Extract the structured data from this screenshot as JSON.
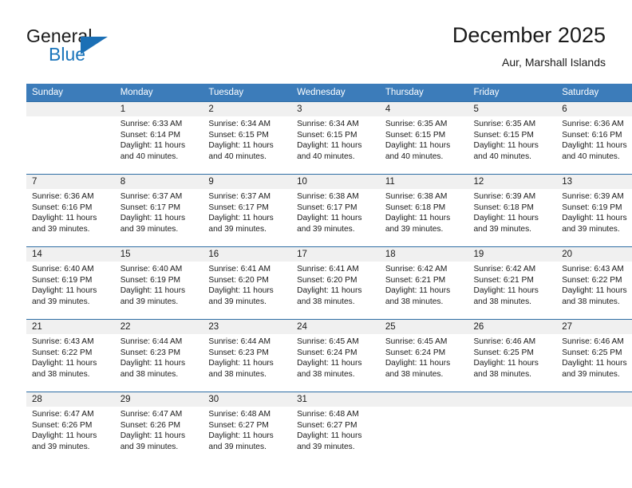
{
  "brand": {
    "name_top": "General",
    "name_bottom": "Blue",
    "accent_color": "#1b75bb",
    "logo_icon": "triangle-flag-icon"
  },
  "header": {
    "month_title": "December 2025",
    "location": "Aur, Marshall Islands"
  },
  "calendar": {
    "header_bg": "#3c7cba",
    "row_divider_color": "#2e6da4",
    "daynum_band_bg": "#f0f0f0",
    "weekday_headers": [
      "Sunday",
      "Monday",
      "Tuesday",
      "Wednesday",
      "Thursday",
      "Friday",
      "Saturday"
    ],
    "weeks": [
      [
        {
          "day": "",
          "sunrise": "",
          "sunset": "",
          "daylight_line1": "",
          "daylight_line2": "",
          "empty": true
        },
        {
          "day": "1",
          "sunrise": "Sunrise: 6:33 AM",
          "sunset": "Sunset: 6:14 PM",
          "daylight_line1": "Daylight: 11 hours",
          "daylight_line2": "and 40 minutes."
        },
        {
          "day": "2",
          "sunrise": "Sunrise: 6:34 AM",
          "sunset": "Sunset: 6:15 PM",
          "daylight_line1": "Daylight: 11 hours",
          "daylight_line2": "and 40 minutes."
        },
        {
          "day": "3",
          "sunrise": "Sunrise: 6:34 AM",
          "sunset": "Sunset: 6:15 PM",
          "daylight_line1": "Daylight: 11 hours",
          "daylight_line2": "and 40 minutes."
        },
        {
          "day": "4",
          "sunrise": "Sunrise: 6:35 AM",
          "sunset": "Sunset: 6:15 PM",
          "daylight_line1": "Daylight: 11 hours",
          "daylight_line2": "and 40 minutes."
        },
        {
          "day": "5",
          "sunrise": "Sunrise: 6:35 AM",
          "sunset": "Sunset: 6:15 PM",
          "daylight_line1": "Daylight: 11 hours",
          "daylight_line2": "and 40 minutes."
        },
        {
          "day": "6",
          "sunrise": "Sunrise: 6:36 AM",
          "sunset": "Sunset: 6:16 PM",
          "daylight_line1": "Daylight: 11 hours",
          "daylight_line2": "and 40 minutes."
        }
      ],
      [
        {
          "day": "7",
          "sunrise": "Sunrise: 6:36 AM",
          "sunset": "Sunset: 6:16 PM",
          "daylight_line1": "Daylight: 11 hours",
          "daylight_line2": "and 39 minutes."
        },
        {
          "day": "8",
          "sunrise": "Sunrise: 6:37 AM",
          "sunset": "Sunset: 6:17 PM",
          "daylight_line1": "Daylight: 11 hours",
          "daylight_line2": "and 39 minutes."
        },
        {
          "day": "9",
          "sunrise": "Sunrise: 6:37 AM",
          "sunset": "Sunset: 6:17 PM",
          "daylight_line1": "Daylight: 11 hours",
          "daylight_line2": "and 39 minutes."
        },
        {
          "day": "10",
          "sunrise": "Sunrise: 6:38 AM",
          "sunset": "Sunset: 6:17 PM",
          "daylight_line1": "Daylight: 11 hours",
          "daylight_line2": "and 39 minutes."
        },
        {
          "day": "11",
          "sunrise": "Sunrise: 6:38 AM",
          "sunset": "Sunset: 6:18 PM",
          "daylight_line1": "Daylight: 11 hours",
          "daylight_line2": "and 39 minutes."
        },
        {
          "day": "12",
          "sunrise": "Sunrise: 6:39 AM",
          "sunset": "Sunset: 6:18 PM",
          "daylight_line1": "Daylight: 11 hours",
          "daylight_line2": "and 39 minutes."
        },
        {
          "day": "13",
          "sunrise": "Sunrise: 6:39 AM",
          "sunset": "Sunset: 6:19 PM",
          "daylight_line1": "Daylight: 11 hours",
          "daylight_line2": "and 39 minutes."
        }
      ],
      [
        {
          "day": "14",
          "sunrise": "Sunrise: 6:40 AM",
          "sunset": "Sunset: 6:19 PM",
          "daylight_line1": "Daylight: 11 hours",
          "daylight_line2": "and 39 minutes."
        },
        {
          "day": "15",
          "sunrise": "Sunrise: 6:40 AM",
          "sunset": "Sunset: 6:19 PM",
          "daylight_line1": "Daylight: 11 hours",
          "daylight_line2": "and 39 minutes."
        },
        {
          "day": "16",
          "sunrise": "Sunrise: 6:41 AM",
          "sunset": "Sunset: 6:20 PM",
          "daylight_line1": "Daylight: 11 hours",
          "daylight_line2": "and 39 minutes."
        },
        {
          "day": "17",
          "sunrise": "Sunrise: 6:41 AM",
          "sunset": "Sunset: 6:20 PM",
          "daylight_line1": "Daylight: 11 hours",
          "daylight_line2": "and 38 minutes."
        },
        {
          "day": "18",
          "sunrise": "Sunrise: 6:42 AM",
          "sunset": "Sunset: 6:21 PM",
          "daylight_line1": "Daylight: 11 hours",
          "daylight_line2": "and 38 minutes."
        },
        {
          "day": "19",
          "sunrise": "Sunrise: 6:42 AM",
          "sunset": "Sunset: 6:21 PM",
          "daylight_line1": "Daylight: 11 hours",
          "daylight_line2": "and 38 minutes."
        },
        {
          "day": "20",
          "sunrise": "Sunrise: 6:43 AM",
          "sunset": "Sunset: 6:22 PM",
          "daylight_line1": "Daylight: 11 hours",
          "daylight_line2": "and 38 minutes."
        }
      ],
      [
        {
          "day": "21",
          "sunrise": "Sunrise: 6:43 AM",
          "sunset": "Sunset: 6:22 PM",
          "daylight_line1": "Daylight: 11 hours",
          "daylight_line2": "and 38 minutes."
        },
        {
          "day": "22",
          "sunrise": "Sunrise: 6:44 AM",
          "sunset": "Sunset: 6:23 PM",
          "daylight_line1": "Daylight: 11 hours",
          "daylight_line2": "and 38 minutes."
        },
        {
          "day": "23",
          "sunrise": "Sunrise: 6:44 AM",
          "sunset": "Sunset: 6:23 PM",
          "daylight_line1": "Daylight: 11 hours",
          "daylight_line2": "and 38 minutes."
        },
        {
          "day": "24",
          "sunrise": "Sunrise: 6:45 AM",
          "sunset": "Sunset: 6:24 PM",
          "daylight_line1": "Daylight: 11 hours",
          "daylight_line2": "and 38 minutes."
        },
        {
          "day": "25",
          "sunrise": "Sunrise: 6:45 AM",
          "sunset": "Sunset: 6:24 PM",
          "daylight_line1": "Daylight: 11 hours",
          "daylight_line2": "and 38 minutes."
        },
        {
          "day": "26",
          "sunrise": "Sunrise: 6:46 AM",
          "sunset": "Sunset: 6:25 PM",
          "daylight_line1": "Daylight: 11 hours",
          "daylight_line2": "and 38 minutes."
        },
        {
          "day": "27",
          "sunrise": "Sunrise: 6:46 AM",
          "sunset": "Sunset: 6:25 PM",
          "daylight_line1": "Daylight: 11 hours",
          "daylight_line2": "and 39 minutes."
        }
      ],
      [
        {
          "day": "28",
          "sunrise": "Sunrise: 6:47 AM",
          "sunset": "Sunset: 6:26 PM",
          "daylight_line1": "Daylight: 11 hours",
          "daylight_line2": "and 39 minutes."
        },
        {
          "day": "29",
          "sunrise": "Sunrise: 6:47 AM",
          "sunset": "Sunset: 6:26 PM",
          "daylight_line1": "Daylight: 11 hours",
          "daylight_line2": "and 39 minutes."
        },
        {
          "day": "30",
          "sunrise": "Sunrise: 6:48 AM",
          "sunset": "Sunset: 6:27 PM",
          "daylight_line1": "Daylight: 11 hours",
          "daylight_line2": "and 39 minutes."
        },
        {
          "day": "31",
          "sunrise": "Sunrise: 6:48 AM",
          "sunset": "Sunset: 6:27 PM",
          "daylight_line1": "Daylight: 11 hours",
          "daylight_line2": "and 39 minutes."
        },
        {
          "day": "",
          "sunrise": "",
          "sunset": "",
          "daylight_line1": "",
          "daylight_line2": "",
          "empty": true
        },
        {
          "day": "",
          "sunrise": "",
          "sunset": "",
          "daylight_line1": "",
          "daylight_line2": "",
          "empty": true
        },
        {
          "day": "",
          "sunrise": "",
          "sunset": "",
          "daylight_line1": "",
          "daylight_line2": "",
          "empty": true
        }
      ]
    ]
  }
}
